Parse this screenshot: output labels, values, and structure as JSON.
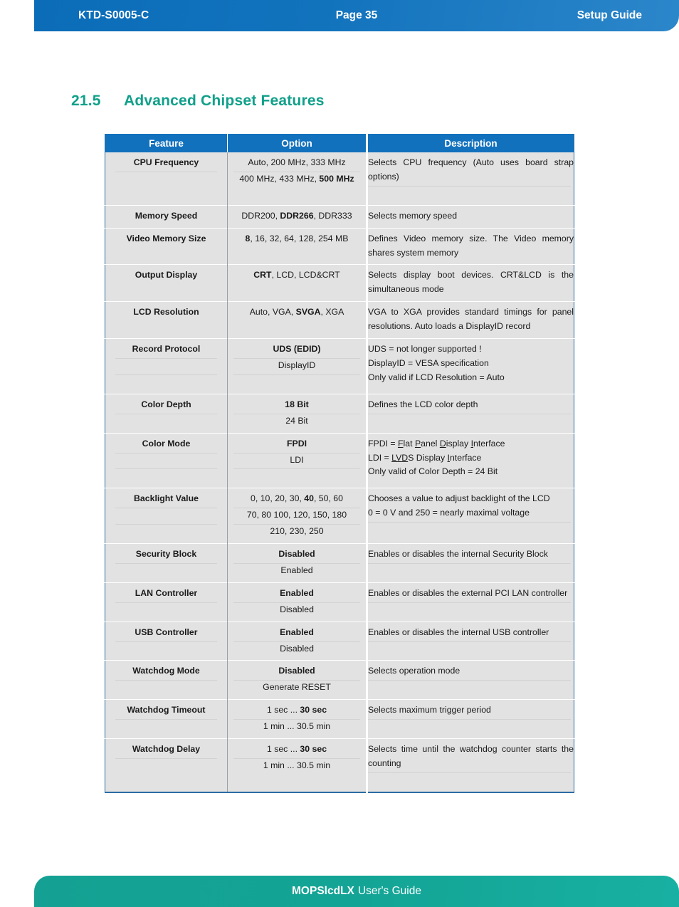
{
  "header": {
    "doc_id": "KTD-S0005-C",
    "page_label": "Page 35",
    "guide_label": "Setup Guide"
  },
  "heading": {
    "number": "21.5",
    "title": "Advanced Chipset Features"
  },
  "table": {
    "columns": [
      "Feature",
      "Option",
      "Description"
    ],
    "rows": [
      {
        "feature": "CPU Frequency",
        "option_lines": [
          "Auto, 200 MHz, 333 MHz",
          "400 MHz, 433 MHz, 500 MHz"
        ],
        "option_bold": [
          "500 MHz"
        ],
        "description_lines": [
          "Selects CPU frequency (Auto uses board strap options)"
        ]
      },
      {
        "feature": "Memory Speed",
        "option_lines": [
          "DDR200, DDR266, DDR333"
        ],
        "option_bold": [
          "DDR266"
        ],
        "description_lines": [
          "Selects memory speed"
        ]
      },
      {
        "feature": "Video Memory Size",
        "option_lines": [
          "8, 16, 32, 64, 128, 254 MB"
        ],
        "option_bold": [
          "8"
        ],
        "description_lines": [
          "Defines Video memory size. The Video memory shares system memory"
        ]
      },
      {
        "feature": "Output Display",
        "option_lines": [
          "CRT, LCD, LCD&CRT"
        ],
        "option_bold": [
          "CRT"
        ],
        "description_lines": [
          "Selects display boot devices. CRT&LCD is the simultaneous mode"
        ]
      },
      {
        "feature": "LCD Resolution",
        "option_lines": [
          "Auto, VGA, SVGA, XGA"
        ],
        "option_bold": [
          "SVGA"
        ],
        "description_lines": [
          "VGA to XGA provides standard timings for panel resolutions. Auto loads a DisplayID record"
        ]
      },
      {
        "feature": "Record Protocol",
        "option_lines": [
          "UDS (EDID)",
          "DisplayID"
        ],
        "option_bold": [
          "UDS (EDID)"
        ],
        "description_lines": [
          "UDS = not longer supported !",
          "DisplayID = VESA specification",
          "Only valid if LCD Resolution = Auto"
        ]
      },
      {
        "feature": "Color Depth",
        "option_lines": [
          "18 Bit",
          "24 Bit"
        ],
        "option_bold": [
          "18 Bit"
        ],
        "description_lines": [
          "Defines the LCD color depth"
        ]
      },
      {
        "feature": "Color Mode",
        "option_lines": [
          "FPDI",
          "LDI"
        ],
        "option_bold": [
          "FPDI"
        ],
        "description_lines": [
          "FPDI = Flat Panel Display Interface",
          "LDI = LVDS Display Interface",
          "Only valid of Color Depth = 24 Bit"
        ]
      },
      {
        "feature": "Backlight Value",
        "option_lines": [
          "0, 10, 20, 30, 40, 50, 60",
          "70, 80 100, 120, 150, 180",
          "210, 230, 250"
        ],
        "option_bold": [
          "40"
        ],
        "description_lines": [
          "Chooses a value to adjust backlight of the LCD",
          "0 = 0 V and 250 = nearly maximal voltage"
        ]
      },
      {
        "feature": "Security Block",
        "option_lines": [
          "Disabled",
          "Enabled"
        ],
        "option_bold": [
          "Disabled"
        ],
        "description_lines": [
          "Enables or disables the internal Security Block"
        ]
      },
      {
        "feature": "LAN Controller",
        "option_lines": [
          "Enabled",
          "Disabled"
        ],
        "option_bold": [
          "Enabled"
        ],
        "description_lines": [
          "Enables or disables the external PCI LAN controller"
        ]
      },
      {
        "feature": "USB Controller",
        "option_lines": [
          "Enabled",
          "Disabled"
        ],
        "option_bold": [
          "Enabled"
        ],
        "description_lines": [
          "Enables or disables the internal USB controller"
        ]
      },
      {
        "feature": "Watchdog Mode",
        "option_lines": [
          "Disabled",
          "Generate RESET"
        ],
        "option_bold": [
          "Disabled"
        ],
        "description_lines": [
          "Selects operation mode"
        ]
      },
      {
        "feature": "Watchdog Timeout",
        "option_lines": [
          "1 sec ... 30 sec",
          "1 min ... 30.5 min"
        ],
        "option_bold": [
          "30 sec"
        ],
        "description_lines": [
          "Selects maximum trigger period"
        ]
      },
      {
        "feature": "Watchdog Delay",
        "option_lines": [
          "1 sec ... 30 sec",
          "1 min ... 30.5 min"
        ],
        "option_bold": [
          "30 sec"
        ],
        "description_lines": [
          "Selects time until the watchdog counter starts the counting"
        ]
      }
    ]
  },
  "footer": {
    "product": "MOPSlcdLX",
    "suffix": "User's Guide"
  },
  "colors": {
    "header_blue": "#1271bd",
    "heading_teal": "#10a08a",
    "footer_teal": "#14a193",
    "feature_blue": "#1763a8",
    "cell_gray": "#e2e2e2",
    "table_border": "#2b6ca3"
  }
}
